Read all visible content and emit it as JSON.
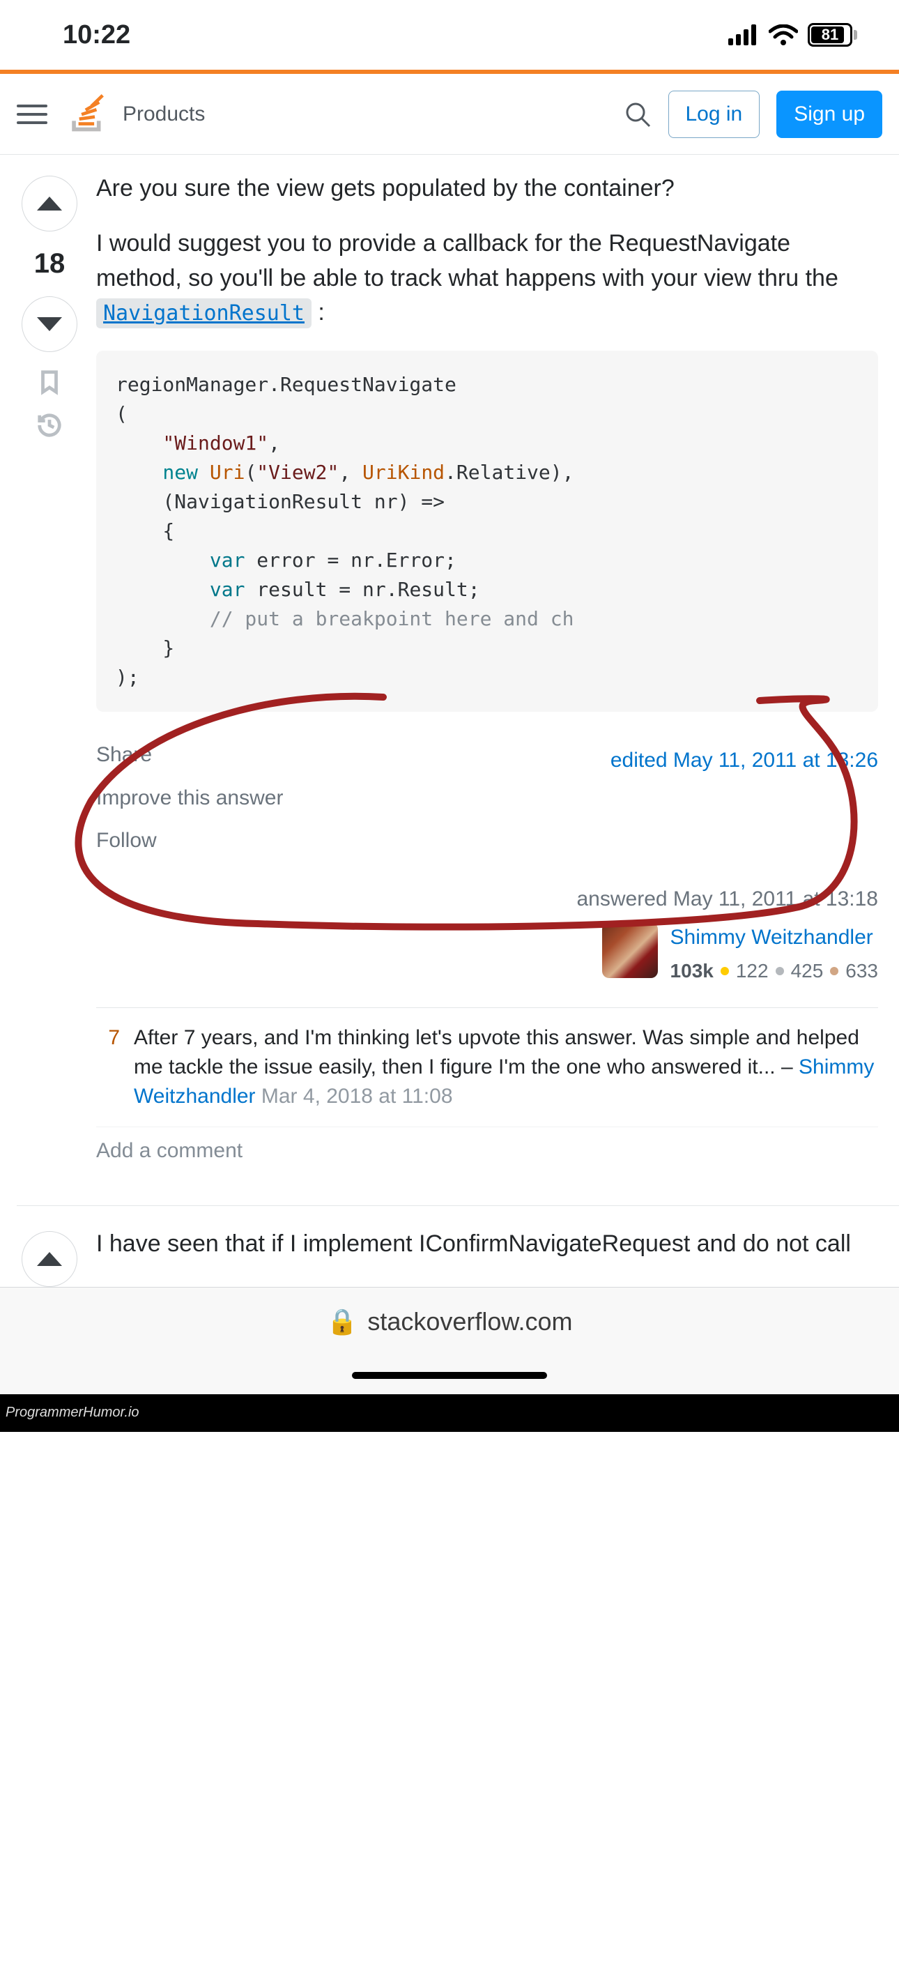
{
  "status_bar": {
    "time": "10:22",
    "battery_pct": "81"
  },
  "header": {
    "nav_label": "Products",
    "login_label": "Log in",
    "signup_label": "Sign up"
  },
  "answer1": {
    "score": "18",
    "para1": "Are you sure the view gets populated by the container?",
    "para2_prefix": "I would suggest you to provide a callback for the RequestNavigate method, so you'll be able to track what happens with your view thru the ",
    "para2_code": "NavigationResult",
    "para2_suffix": " :",
    "code_lines": [
      {
        "t": "plain",
        "v": "regionManager.RequestNavigate"
      },
      {
        "t": "plain",
        "v": "("
      },
      {
        "t": "str",
        "v": "    \"Window1\""
      },
      {
        "t": "plain-inline",
        "v": ","
      },
      {
        "t": "mixed",
        "parts": [
          {
            "c": "kw",
            "v": "    new "
          },
          {
            "c": "typ",
            "v": "Uri"
          },
          {
            "c": "plain",
            "v": "("
          },
          {
            "c": "str",
            "v": "\"View2\""
          },
          {
            "c": "plain",
            "v": ", "
          },
          {
            "c": "typ",
            "v": "UriKind"
          },
          {
            "c": "plain",
            "v": ".Relative),"
          }
        ]
      },
      {
        "t": "plain",
        "v": "    (NavigationResult nr) =>"
      },
      {
        "t": "plain",
        "v": "    {"
      },
      {
        "t": "mixed",
        "parts": [
          {
            "c": "var",
            "v": "        var"
          },
          {
            "c": "plain",
            "v": " error = nr.Error;"
          }
        ]
      },
      {
        "t": "mixed",
        "parts": [
          {
            "c": "var",
            "v": "        var"
          },
          {
            "c": "plain",
            "v": " result = nr.Result;"
          }
        ]
      },
      {
        "t": "com",
        "v": "        // put a breakpoint here and ch"
      },
      {
        "t": "plain",
        "v": "    }"
      },
      {
        "t": "plain",
        "v": ");"
      }
    ],
    "actions": {
      "share": "Share",
      "improve": "Improve this answer",
      "follow": "Follow"
    },
    "edited": "edited May 11, 2011 at 13:26",
    "answered": "answered May 11, 2011 at 13:18",
    "user": {
      "name": "Shimmy Weitzhandler",
      "rep": "103k",
      "gold": "122",
      "silver": "425",
      "bronze": "633"
    },
    "comment": {
      "score": "7",
      "text": "After 7 years, and I'm thinking let's upvote this answer. Was simple and helped me tackle the issue easily, then I figure I'm the one who answered it... – ",
      "user": "Shimmy Weitzhandler",
      "date": " Mar 4, 2018 at 11:08"
    },
    "add_comment": "Add a comment"
  },
  "answer2": {
    "para": "I have seen that if I implement IConfirmNavigateRequest and do not call"
  },
  "browser": {
    "domain": "stackoverflow.com"
  },
  "footer": {
    "watermark": "ProgrammerHumor.io"
  }
}
